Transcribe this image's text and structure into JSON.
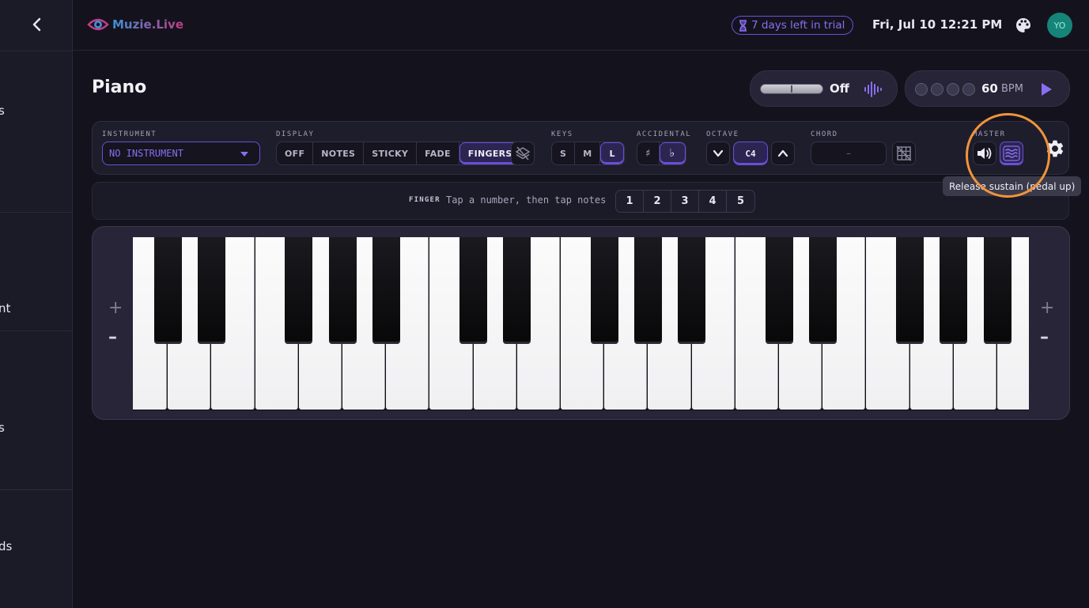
{
  "sidebar": {
    "fragments": [
      "s",
      "nt",
      "s",
      "ds"
    ]
  },
  "header": {
    "logo_text": "Muzie.Live",
    "trial_text": "7 days left in trial",
    "datetime": "Fri, Jul 10 12:21 PM",
    "avatar_initials": "YO"
  },
  "page": {
    "title": "Piano"
  },
  "metronome": {
    "toggle_label": "Off",
    "bpm_value": "60",
    "bpm_unit": "BPM"
  },
  "toolbar": {
    "instrument_label": "INSTRUMENT",
    "instrument_value": "NO INSTRUMENT",
    "display_label": "DISPLAY",
    "display_options": [
      "OFF",
      "NOTES",
      "STICKY",
      "FADE",
      "FINGERS"
    ],
    "display_selected": "FINGERS",
    "keys_label": "KEYS",
    "keys_options": [
      "S",
      "M",
      "L"
    ],
    "keys_selected": "L",
    "accidental_label": "ACCIDENTAL",
    "accidental_options": [
      "♯",
      "♭"
    ],
    "accidental_selected": "♭",
    "octave_label": "OCTAVE",
    "octave_value": "C4",
    "chord_label": "CHORD",
    "chord_value": "–",
    "master_label": "MASTER"
  },
  "tooltip": {
    "text": "Release sustain (pedal up)"
  },
  "finger": {
    "label": "FINGER",
    "hint": "Tap a number, then tap notes",
    "numbers": [
      "1",
      "2",
      "3",
      "4",
      "5"
    ]
  },
  "keyboard": {
    "zoom_in_label": "+",
    "zoom_out_label": "–"
  },
  "colors": {
    "accent": "#6b4fd8",
    "highlight_ring": "#f0943c",
    "avatar_bg": "#15857a"
  }
}
